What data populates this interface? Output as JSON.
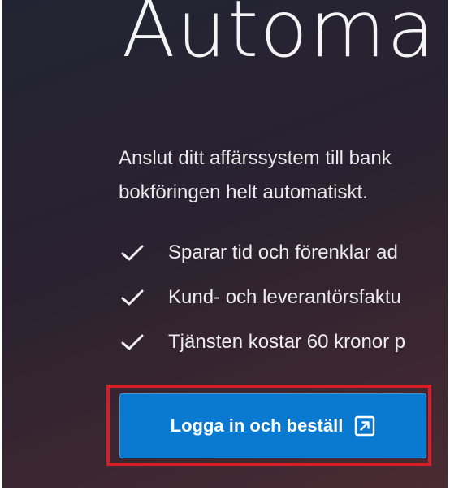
{
  "hero": {
    "heading": "Automa",
    "intro_lines": [
      "Anslut ditt affärssystem till bank",
      "bokföringen helt automatiskt."
    ],
    "features": [
      {
        "icon": "checkmark-icon",
        "text": "Sparar tid och förenklar ad"
      },
      {
        "icon": "checkmark-icon",
        "text": "Kund- och leverantörsfaktu"
      },
      {
        "icon": "checkmark-icon",
        "text": "Tjänsten kostar 60 kronor p"
      }
    ],
    "cta": {
      "label": "Logga in och beställ",
      "icon": "external-link-icon"
    }
  },
  "colors": {
    "cta_background": "#0a7ad1",
    "highlight_border": "#d81d2a",
    "background_dark": "#232433",
    "text": "#ececf1"
  }
}
